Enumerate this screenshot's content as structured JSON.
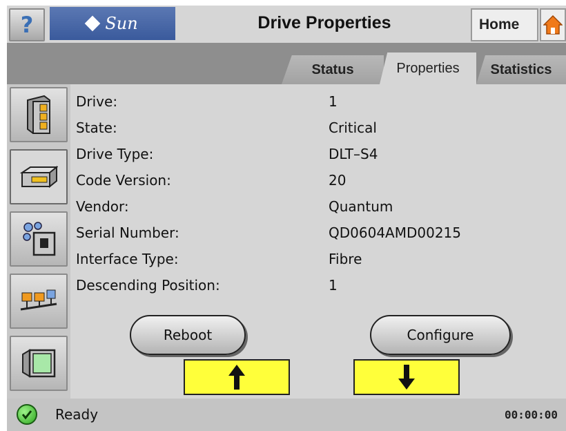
{
  "header": {
    "help_label": "?",
    "logo_text": "Sun",
    "title": "Drive Properties",
    "home_label": "Home",
    "home_icon": "house-icon"
  },
  "tabs": [
    {
      "label": "Status",
      "active": false
    },
    {
      "label": "Properties",
      "active": true
    },
    {
      "label": "Statistics",
      "active": false
    }
  ],
  "sidebar": {
    "items": [
      {
        "icon": "library-cabinet-icon",
        "active": false
      },
      {
        "icon": "tape-drive-icon",
        "active": true
      },
      {
        "icon": "cartridge-slots-icon",
        "active": false
      },
      {
        "icon": "network-icon",
        "active": false
      },
      {
        "icon": "monitor-icon",
        "active": false
      }
    ]
  },
  "properties": [
    {
      "label": "Drive:",
      "value": "1"
    },
    {
      "label": "State:",
      "value": "Critical"
    },
    {
      "label": "Drive Type:",
      "value": "DLT–S4"
    },
    {
      "label": "Code Version:",
      "value": "20"
    },
    {
      "label": "Vendor:",
      "value": "Quantum"
    },
    {
      "label": "Serial Number:",
      "value": "QD0604AMD00215"
    },
    {
      "label": "Interface Type:",
      "value": "Fibre"
    },
    {
      "label": "Descending Position:",
      "value": "1"
    }
  ],
  "actions": {
    "reboot_label": "Reboot",
    "configure_label": "Configure",
    "up_icon": "arrow-up-icon",
    "down_icon": "arrow-down-icon"
  },
  "status": {
    "icon": "check-circle-icon",
    "text": "Ready",
    "clock": "00:00:00"
  },
  "colors": {
    "logo_blue": "#3a5a9c",
    "arrow_yellow": "#ffff3a",
    "ok_green": "#2ea81e",
    "home_orange": "#f07a1a"
  }
}
